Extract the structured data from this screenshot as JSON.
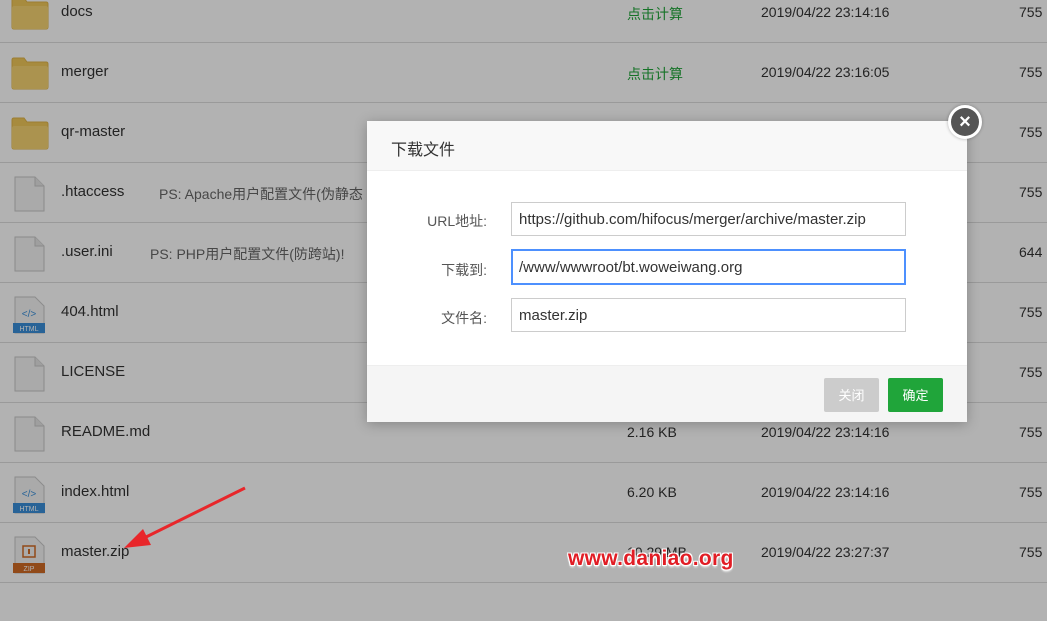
{
  "files": [
    {
      "icon": "folder",
      "name": "docs",
      "note": "",
      "size": "点击计算",
      "size_is_calc": true,
      "mtime": "2019/04/22 23:14:16",
      "perm": "755"
    },
    {
      "icon": "folder",
      "name": "merger",
      "note": "",
      "size": "点击计算",
      "size_is_calc": true,
      "mtime": "2019/04/22 23:16:05",
      "perm": "755"
    },
    {
      "icon": "folder",
      "name": "qr-master",
      "note": "",
      "size": "",
      "size_is_calc": false,
      "mtime": "",
      "perm": "755"
    },
    {
      "icon": "file",
      "name": ".htaccess",
      "note": "PS: Apache用户配置文件(伪静态",
      "size": "",
      "size_is_calc": false,
      "mtime": "",
      "perm": "755"
    },
    {
      "icon": "file",
      "name": ".user.ini",
      "note": "PS: PHP用户配置文件(防跨站)!",
      "size": "",
      "size_is_calc": false,
      "mtime": "",
      "perm": "644"
    },
    {
      "icon": "html",
      "name": "404.html",
      "note": "",
      "size": "",
      "size_is_calc": false,
      "mtime": "",
      "perm": "755"
    },
    {
      "icon": "file",
      "name": "LICENSE",
      "note": "",
      "size": "",
      "size_is_calc": false,
      "mtime": "",
      "perm": "755"
    },
    {
      "icon": "file",
      "name": "README.md",
      "note": "",
      "size": "2.16 KB",
      "size_is_calc": false,
      "mtime": "2019/04/22 23:14:16",
      "perm": "755"
    },
    {
      "icon": "html",
      "name": "index.html",
      "note": "",
      "size": "6.20 KB",
      "size_is_calc": false,
      "mtime": "2019/04/22 23:14:16",
      "perm": "755"
    },
    {
      "icon": "zip",
      "name": "master.zip",
      "note": "",
      "size": "10.29 MB",
      "size_is_calc": false,
      "mtime": "2019/04/22 23:27:37",
      "perm": "755"
    }
  ],
  "icon_labels": {
    "html": "HTML",
    "html_code": "</>",
    "zip": "ZIP"
  },
  "dialog": {
    "title": "下载文件",
    "close_symbol": "×",
    "url_label": "URL地址:",
    "url_value": "https://github.com/hifocus/merger/archive/master.zip",
    "path_label": "下载到:",
    "path_value": "/www/wwwroot/bt.woweiwang.org",
    "filename_label": "文件名:",
    "filename_value": "master.zip",
    "btn_close": "关闭",
    "btn_confirm": "确定"
  },
  "watermark": "www.daniao.org",
  "colors": {
    "accent_green": "#20a53a",
    "folder_yellow": "#f0c85a",
    "arrow_red": "#e8262a",
    "watermark_red": "#e11d25",
    "focus_blue": "#4d90fe"
  }
}
